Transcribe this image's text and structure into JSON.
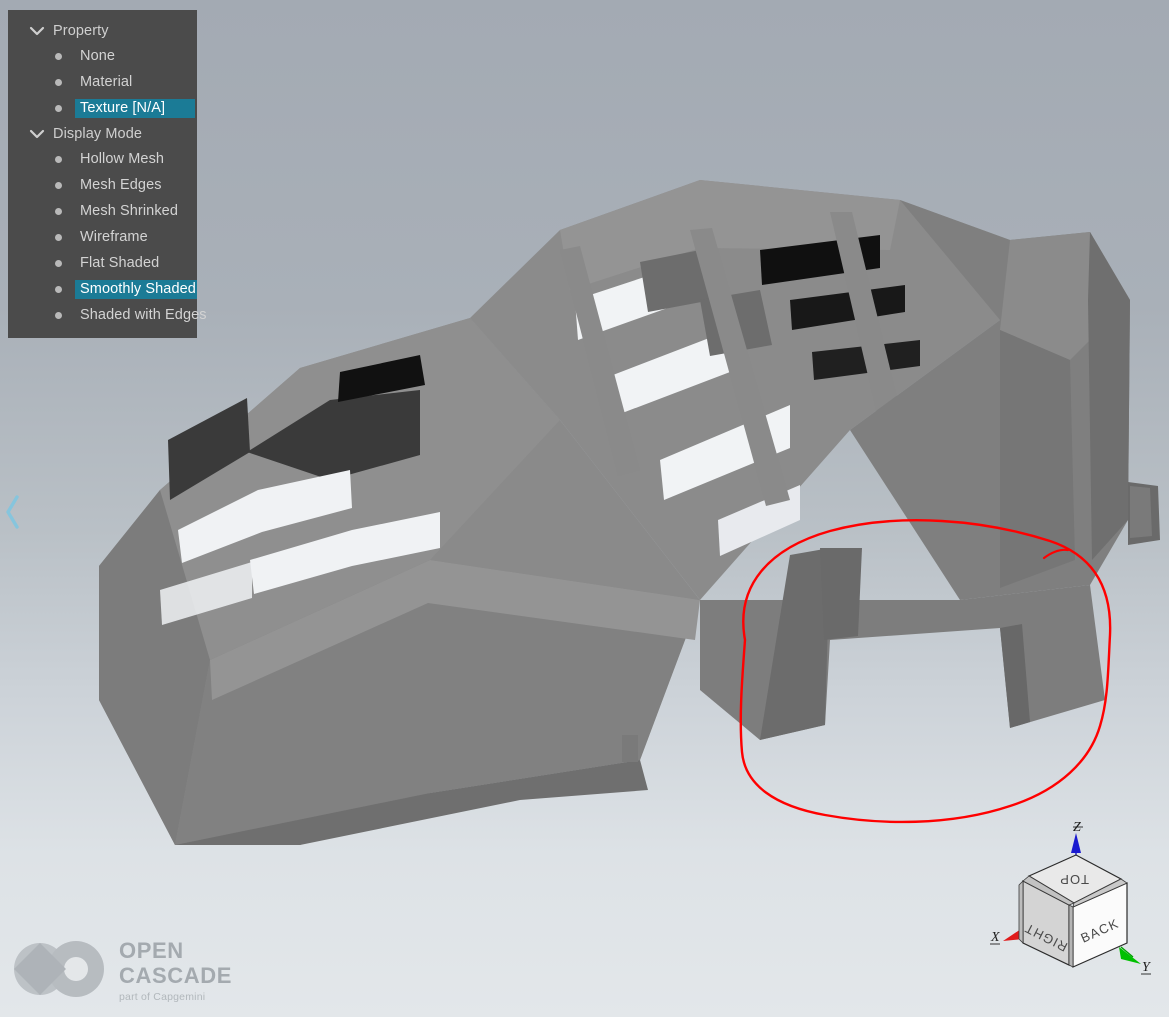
{
  "app": {
    "name": "OPEN CASCADE 3D Viewer",
    "background_top_color": "#a3aab3",
    "background_bottom_color": "#e3e7ea"
  },
  "menu": {
    "highlight_color": "#1b7b96",
    "panel_color": "#4b4b4b",
    "groups": [
      {
        "label": "Property",
        "expanded": true,
        "chevron_icon": "chevron-down-icon",
        "items": [
          {
            "label": "None",
            "selected": false
          },
          {
            "label": "Material",
            "selected": false
          },
          {
            "label": "Texture [N/A]",
            "selected": true
          }
        ]
      },
      {
        "label": "Display Mode",
        "expanded": true,
        "chevron_icon": "chevron-down-icon",
        "items": [
          {
            "label": "Hollow Mesh",
            "selected": false
          },
          {
            "label": "Mesh Edges",
            "selected": false
          },
          {
            "label": "Mesh Shrinked",
            "selected": false
          },
          {
            "label": "Wireframe",
            "selected": false
          },
          {
            "label": "Flat Shaded",
            "selected": false
          },
          {
            "label": "Smoothly Shaded",
            "selected": true
          },
          {
            "label": "Shaded with Edges",
            "selected": false
          }
        ]
      }
    ]
  },
  "collapse_handle": {
    "icon": "chevron-left-icon",
    "color": "#86c5dd"
  },
  "logo": {
    "line1": "OPEN",
    "line2": "CASCADE",
    "tagline": "part of Capgemini",
    "color": "#9aa0a6"
  },
  "view_cube": {
    "faces": {
      "top": "TOP",
      "right": "RIGHT",
      "front": "BACK"
    },
    "axes": [
      {
        "label": "X",
        "color": "#e01b1b"
      },
      {
        "label": "Y",
        "color": "#00c000"
      },
      {
        "label": "Z",
        "color": "#1a1ad0"
      }
    ]
  },
  "annotation": {
    "shape": "freehand-ellipse",
    "color": "#ff0000",
    "stroke_width": 2.4
  },
  "model": {
    "description": "Faceted triangulated mesh of an engine-block / cylinder-head style part, smoothly shaded grey",
    "shading": "Smoothly Shaded"
  }
}
